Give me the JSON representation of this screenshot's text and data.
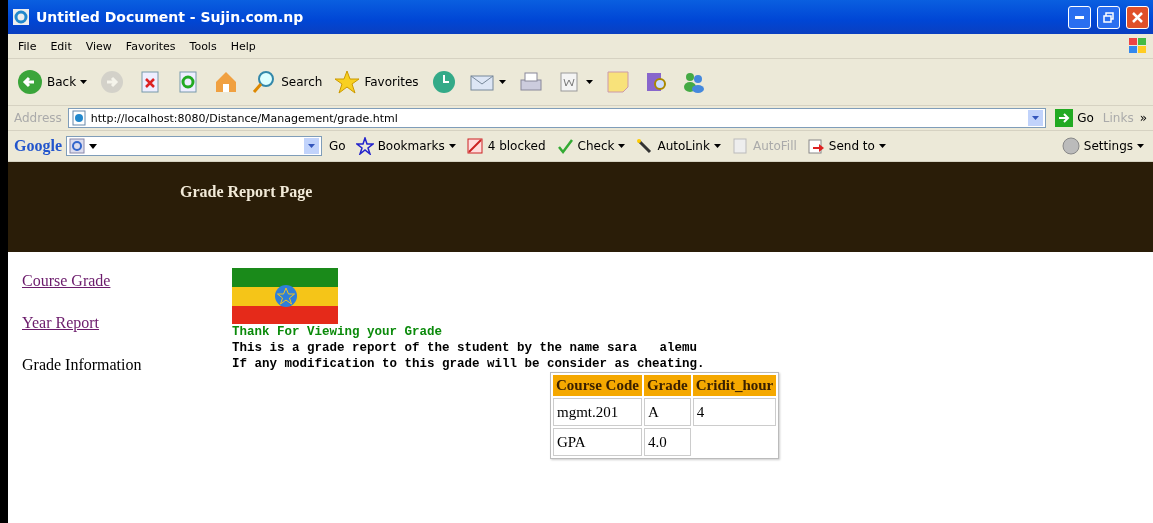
{
  "window": {
    "title": "Untitled Document - Sujin.com.np"
  },
  "menu": [
    "File",
    "Edit",
    "View",
    "Favorites",
    "Tools",
    "Help"
  ],
  "toolbar": [
    {
      "kind": "back",
      "label": "Back",
      "dropdown": true,
      "disabled": false
    },
    {
      "kind": "forward",
      "disabled": true,
      "dropdown": false
    },
    {
      "kind": "stop",
      "disabled": false,
      "dropdown": false
    },
    {
      "kind": "refresh",
      "disabled": false,
      "dropdown": false
    },
    {
      "kind": "home",
      "disabled": false,
      "dropdown": false
    },
    {
      "kind": "search",
      "label": "Search",
      "disabled": false,
      "dropdown": false
    },
    {
      "kind": "favorites",
      "label": "Favorites",
      "disabled": false,
      "dropdown": false
    },
    {
      "kind": "history",
      "disabled": false,
      "dropdown": false
    },
    {
      "kind": "mail",
      "disabled": false,
      "dropdown": true
    },
    {
      "kind": "print",
      "disabled": false,
      "dropdown": false
    },
    {
      "kind": "edit",
      "disabled": false,
      "dropdown": true
    },
    {
      "kind": "note",
      "disabled": false,
      "dropdown": false
    },
    {
      "kind": "research",
      "disabled": false,
      "dropdown": false
    },
    {
      "kind": "messenger",
      "disabled": false,
      "dropdown": false
    }
  ],
  "address": {
    "label": "Address",
    "value": "http://localhost:8080/Distance/Management/grade.html",
    "go": "Go",
    "links": "Links",
    "more": "»"
  },
  "google_bar": {
    "logo": "Google",
    "items": [
      {
        "kind": "go",
        "label": "Go",
        "disabled": false,
        "dropdown": false
      },
      {
        "kind": "bookmarks",
        "label": "Bookmarks",
        "disabled": false,
        "dropdown": true
      },
      {
        "kind": "blocked",
        "label": "4 blocked",
        "disabled": false,
        "dropdown": false
      },
      {
        "kind": "check",
        "label": "Check",
        "disabled": false,
        "dropdown": true
      },
      {
        "kind": "autolink",
        "label": "AutoLink",
        "disabled": false,
        "dropdown": true
      },
      {
        "kind": "autofill",
        "label": "AutoFill",
        "disabled": true,
        "dropdown": false
      },
      {
        "kind": "sendto",
        "label": "Send to",
        "disabled": false,
        "dropdown": true
      }
    ],
    "settings": "Settings"
  },
  "page": {
    "banner_title": "Grade Report Page",
    "sidebar": [
      {
        "kind": "link",
        "label": "Course Grade"
      },
      {
        "kind": "link",
        "label": "Year Report"
      },
      {
        "kind": "text",
        "label": "Grade Information"
      }
    ],
    "thanks": "Thank For Viewing your Grade",
    "lines": [
      "This is a grade report of the student by the name sara   alemu",
      "If any modification to this grade will be consider as cheating."
    ],
    "table": {
      "columns": [
        "Course Code",
        "Grade",
        "Cridit_hour"
      ],
      "rows": [
        [
          "mgmt.201",
          "A",
          "4"
        ],
        [
          "GPA",
          "4.0"
        ]
      ]
    }
  }
}
